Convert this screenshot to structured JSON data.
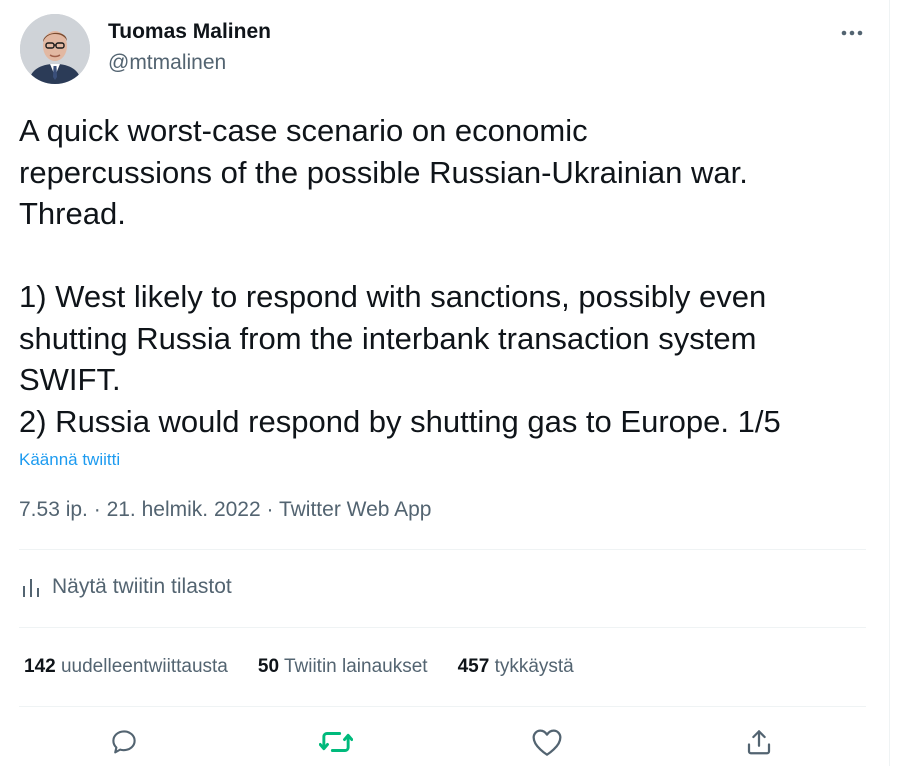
{
  "author": {
    "name": "Tuomas Malinen",
    "handle": "@mtmalinen"
  },
  "tweet": {
    "lines": [
      "A quick worst-case scenario on economic",
      "repercussions of the possible Russian-Ukrainian war.",
      "Thread.",
      "",
      "1) West likely to respond with sanctions, possibly even",
      "shutting Russia from the interbank transaction system",
      "SWIFT.",
      "2) Russia would respond by shutting gas to Europe. 1/5"
    ],
    "translate_label": "Käännä twiitti"
  },
  "meta": {
    "time": "7.53 ip.",
    "separator": " · ",
    "date": "21. helmik. 2022",
    "source": "Twitter Web App"
  },
  "analytics": {
    "label": "Näytä twiitin tilastot",
    "icon": "analytics-icon"
  },
  "stats": {
    "retweets": {
      "count": "142",
      "label": "uudelleentwiittausta"
    },
    "quotes": {
      "count": "50",
      "label": "Twiitin lainaukset"
    },
    "likes": {
      "count": "457",
      "label": "tykkäystä"
    }
  },
  "actions": [
    {
      "icon": "reply-icon"
    },
    {
      "icon": "retweet-icon",
      "active": true
    },
    {
      "icon": "like-icon"
    },
    {
      "icon": "share-icon"
    }
  ],
  "colors": {
    "text": "#0f1419",
    "secondary": "#536471",
    "link": "#1d9bf0",
    "retweet_green": "#00ba7c",
    "divider": "#eff3f4"
  }
}
